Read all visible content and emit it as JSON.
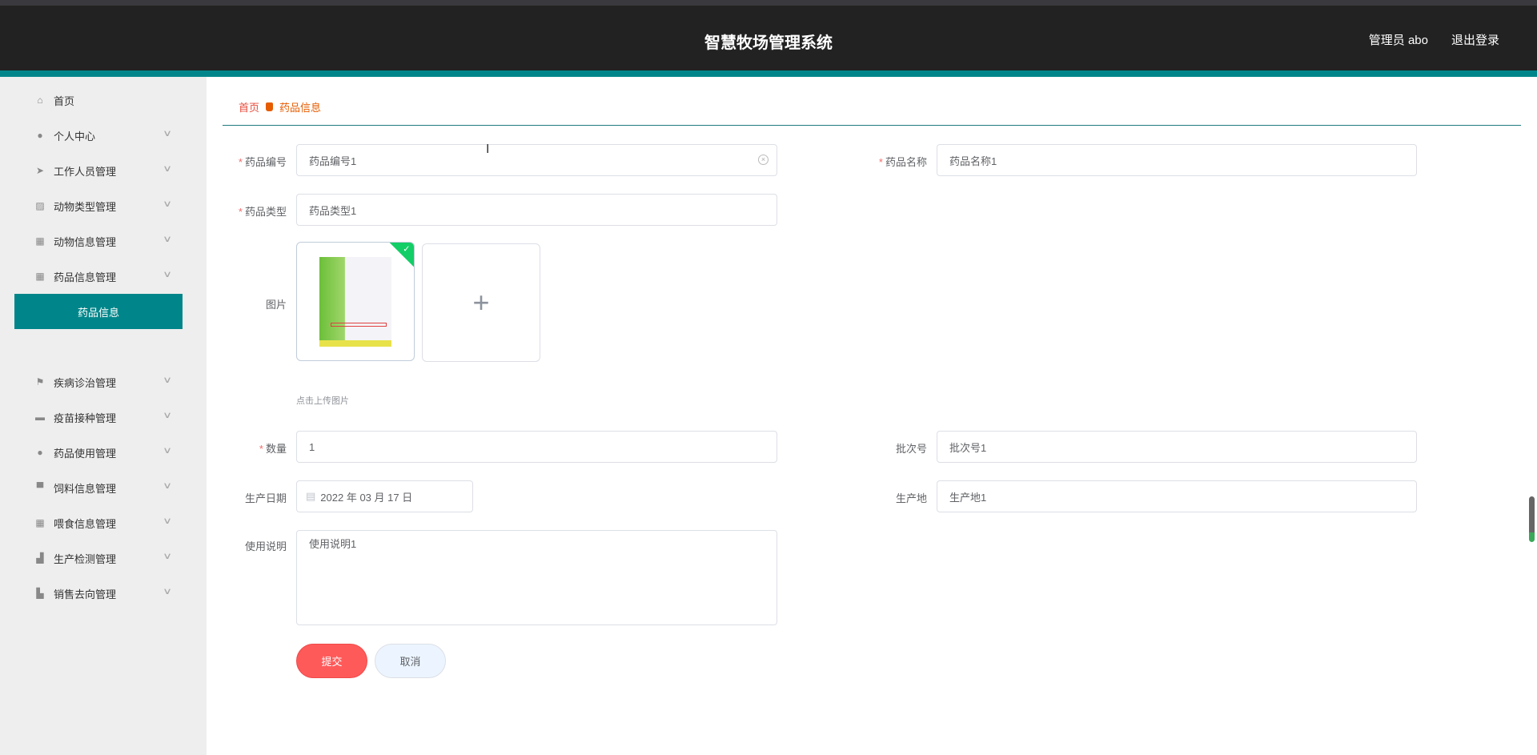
{
  "header": {
    "title": "智慧牧场管理系统",
    "user": "管理员 abo",
    "logout": "退出登录"
  },
  "sidebar": {
    "items": [
      {
        "label": "首页",
        "icon": "home-icon"
      },
      {
        "label": "个人中心",
        "icon": "user-icon"
      },
      {
        "label": "工作人员管理",
        "icon": "send-icon"
      },
      {
        "label": "动物类型管理",
        "icon": "chart-icon"
      },
      {
        "label": "动物信息管理",
        "icon": "grid-icon"
      },
      {
        "label": "药品信息管理",
        "icon": "grid-icon"
      },
      {
        "label": "疾病诊治管理",
        "icon": "flag-icon"
      },
      {
        "label": "疫苗接种管理",
        "icon": "briefcase-icon"
      },
      {
        "label": "药品使用管理",
        "icon": "user-icon"
      },
      {
        "label": "饲料信息管理",
        "icon": "printer-icon"
      },
      {
        "label": "喂食信息管理",
        "icon": "grid-icon"
      },
      {
        "label": "生产检测管理",
        "icon": "factory-icon"
      },
      {
        "label": "销售去向管理",
        "icon": "building-icon"
      }
    ],
    "active_sub": "药品信息"
  },
  "breadcrumb": {
    "home": "首页",
    "current": "药品信息"
  },
  "form": {
    "code": {
      "label": "药品编号",
      "value": "药品编号1"
    },
    "name": {
      "label": "药品名称",
      "value": "药品名称1"
    },
    "type": {
      "label": "药品类型",
      "value": "药品类型1"
    },
    "image": {
      "label": "图片",
      "hint": "点击上传图片"
    },
    "quantity": {
      "label": "数量",
      "value": "1"
    },
    "batch": {
      "label": "批次号",
      "value": "批次号1"
    },
    "date": {
      "label": "生产日期",
      "value": "2022 年 03 月 17 日"
    },
    "origin": {
      "label": "生产地",
      "value": "生产地1"
    },
    "usage": {
      "label": "使用说明",
      "value": "使用说明1"
    },
    "required_mark": "*",
    "submit": "提交",
    "cancel": "取消"
  },
  "colors": {
    "accent": "#00868a",
    "submit": "#ff5a5a",
    "header": "#222222"
  }
}
